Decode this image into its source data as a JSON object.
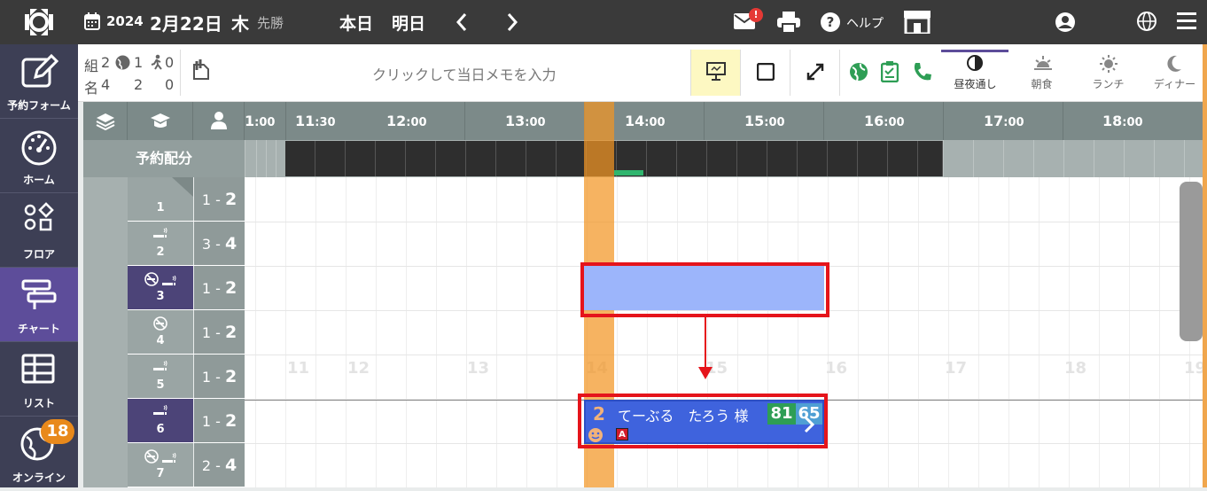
{
  "header": {
    "year": "2024",
    "month_day": "2月22日",
    "day_of_week": "木",
    "rokuyo": "先勝",
    "today_label": "本日",
    "tomorrow_label": "明日",
    "mail_badge": "!",
    "help_label": "ヘルプ"
  },
  "sidebar": {
    "items": [
      {
        "label": "予約フォーム",
        "icon": "edit-icon"
      },
      {
        "label": "ホーム",
        "icon": "gauge-icon"
      },
      {
        "label": "フロア",
        "icon": "shapes-icon"
      },
      {
        "label": "チャート",
        "icon": "chart-icon",
        "active": true
      },
      {
        "label": "リスト",
        "icon": "table-icon"
      },
      {
        "label": "オンライン",
        "icon": "globe-icon",
        "badge": "18"
      }
    ]
  },
  "stats": {
    "kumi_label": "組",
    "kumi": "2",
    "globe_count": "1",
    "walk_count": "0",
    "mei_label": "名",
    "mei": "4",
    "mei_globe": "2",
    "mei_walk": "0"
  },
  "memo_placeholder": "クリックして当日メモを入力",
  "meal_tabs": [
    {
      "label": "昼夜通し",
      "active": true
    },
    {
      "label": "朝食"
    },
    {
      "label": "ランチ"
    },
    {
      "label": "ディナー"
    }
  ],
  "timeline": {
    "ticks": [
      {
        "h": "1",
        "m": ":00"
      },
      {
        "h": "11",
        "m": ":30"
      },
      {
        "h": "12",
        "m": ":00"
      },
      {
        "h": "13",
        "m": ":00"
      },
      {
        "h": "14",
        "m": ":00"
      },
      {
        "h": "15",
        "m": ":00"
      },
      {
        "h": "16",
        "m": ":00"
      },
      {
        "h": "17",
        "m": ":00"
      },
      {
        "h": "18",
        "m": ":00"
      }
    ],
    "alloc_label": "予約配分",
    "hour_numbers": [
      "11",
      "12",
      "13",
      "14",
      "15",
      "16",
      "17",
      "18",
      "19"
    ]
  },
  "tables": [
    {
      "num": "1",
      "cap_min": "1",
      "cap_max": "2",
      "active": false
    },
    {
      "num": "2",
      "cap_min": "3",
      "cap_max": "4",
      "active": false
    },
    {
      "num": "3",
      "cap_min": "1",
      "cap_max": "2",
      "active": true
    },
    {
      "num": "4",
      "cap_min": "1",
      "cap_max": "2",
      "active": false
    },
    {
      "num": "5",
      "cap_min": "1",
      "cap_max": "2",
      "active": false
    },
    {
      "num": "6",
      "cap_min": "1",
      "cap_max": "2",
      "active": true
    },
    {
      "num": "7",
      "cap_min": "2",
      "cap_max": "4",
      "active": false
    }
  ],
  "reservation": {
    "party_size": "2",
    "name": "てーぶる　たろう 様",
    "badge_green": "81",
    "badge_blue": "65",
    "tag": "A"
  },
  "colors": {
    "topbar": "#3a3a3a",
    "sidebar": "#3d3f55",
    "active_nav": "#5d4d9a",
    "now_column": "#f39524",
    "reservation": "#3f63dd",
    "highlight": "#e5141b"
  }
}
